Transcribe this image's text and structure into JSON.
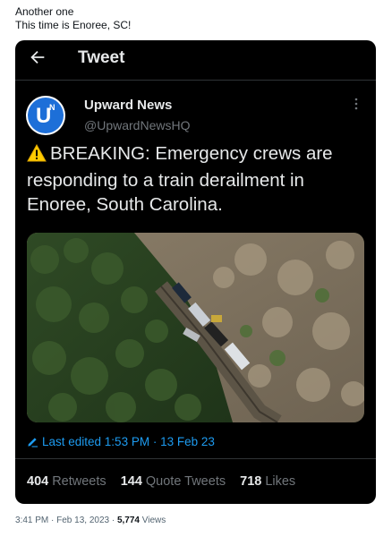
{
  "post": {
    "line1": "Another one",
    "line2": "This time is Enoree, SC!"
  },
  "topbar": {
    "title": "Tweet"
  },
  "author": {
    "avatar_letter": "U",
    "avatar_small": "N",
    "name": "Upward News",
    "handle": "@UpwardNewsHQ"
  },
  "tweet": {
    "text": "BREAKING: Emergency crews are responding to a train derailment in Enoree, South Carolina."
  },
  "media": {
    "alt": "Aerial view of train derailment in wooded area"
  },
  "edit": {
    "label": "Last edited 1:53 PM · 13 Feb 23"
  },
  "stats": {
    "retweets_count": "404",
    "retweets_label": "Retweets",
    "quotes_count": "144",
    "quotes_label": "Quote Tweets",
    "likes_count": "718",
    "likes_label": "Likes"
  },
  "footer": {
    "timestamp": "3:41 PM · Feb 13, 2023 · ",
    "views_count": "5,774",
    "views_label": " Views"
  },
  "colors": {
    "card_bg": "#000000",
    "link_blue": "#1d9bf0",
    "avatar_blue": "#1d6fd8",
    "warning_yellow": "#ffcc00"
  }
}
